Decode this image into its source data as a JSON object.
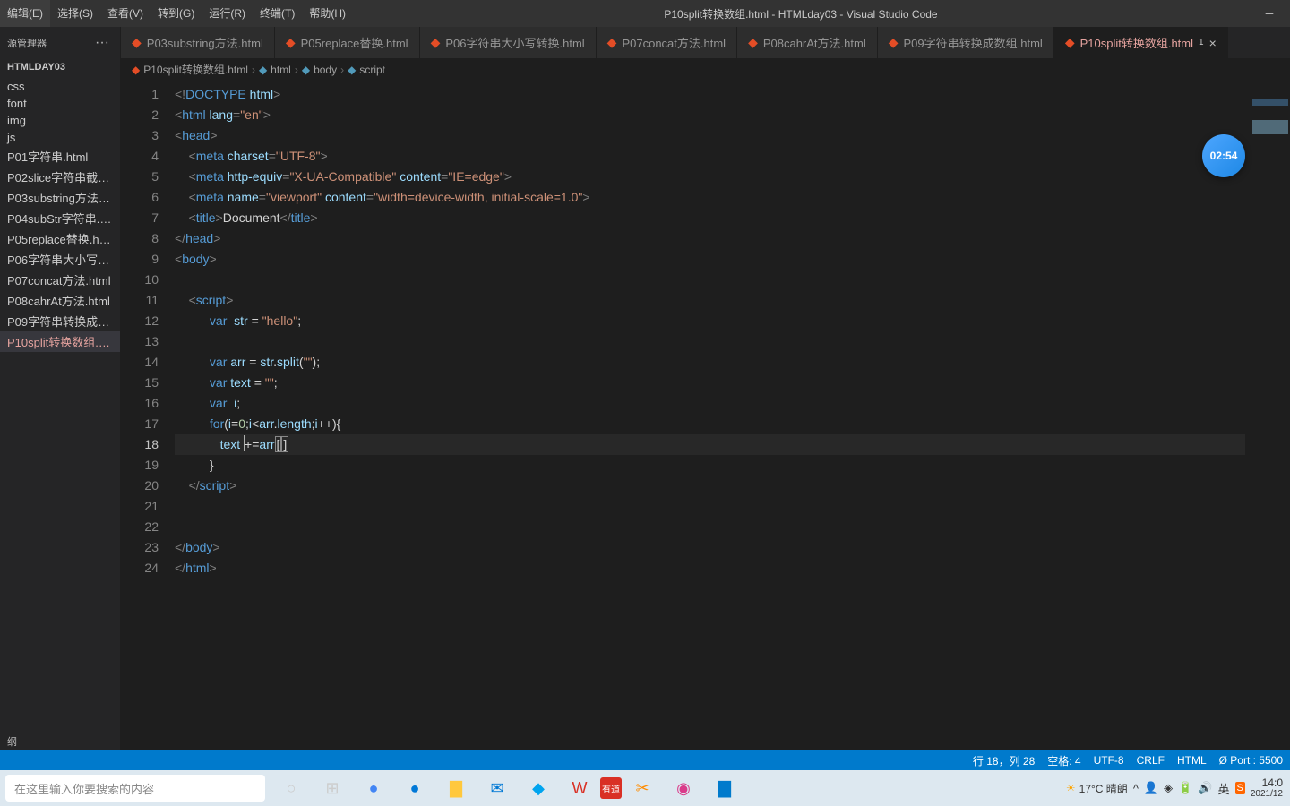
{
  "title": "P10split转换数组.html - HTMLday03 - Visual Studio Code",
  "menu": [
    "编辑(E)",
    "选择(S)",
    "查看(V)",
    "转到(G)",
    "运行(R)",
    "终端(T)",
    "帮助(H)"
  ],
  "sidebar": {
    "title": "源管理器",
    "more": "···",
    "project": "HTMLDAY03",
    "files": [
      {
        "name": "css"
      },
      {
        "name": "font"
      },
      {
        "name": "img"
      },
      {
        "name": "js"
      },
      {
        "name": "P01字符串.html"
      },
      {
        "name": "P02slice字符串截取.ht..."
      },
      {
        "name": "P03substring方法.html"
      },
      {
        "name": "P04subStr字符串.html"
      },
      {
        "name": "P05replace替换.html"
      },
      {
        "name": "P06字符串大小写转换..."
      },
      {
        "name": "P07concat方法.html"
      },
      {
        "name": "P08cahrAt方法.html"
      },
      {
        "name": "P09字符串转换成数组..."
      },
      {
        "name": "P10split转换数组....",
        "active": true,
        "dirty": "1"
      }
    ],
    "outline": "纲"
  },
  "tabs": [
    {
      "label": "P03substring方法.html",
      "active": false,
      "modified": false
    },
    {
      "label": "P05replace替换.html",
      "active": false,
      "modified": false
    },
    {
      "label": "P06字符串大小写转换.html",
      "active": false,
      "modified": false
    },
    {
      "label": "P07concat方法.html",
      "active": false,
      "modified": false
    },
    {
      "label": "P08cahrAt方法.html",
      "active": false,
      "modified": false
    },
    {
      "label": "P09字符串转换成数组.html",
      "active": false,
      "modified": false
    },
    {
      "label": "P10split转换数组.html",
      "active": true,
      "modified": true,
      "dirty": "1"
    }
  ],
  "breadcrumbs": [
    {
      "label": "P10split转换数组.html",
      "icon": "html"
    },
    {
      "label": "html",
      "icon": "tag"
    },
    {
      "label": "body",
      "icon": "tag"
    },
    {
      "label": "script",
      "icon": "tag"
    }
  ],
  "timer_badge": "02:54",
  "lines_count": 24,
  "current_line_idx": 18,
  "statusbar": {
    "line_col": "行 18，列 28",
    "spaces": "空格: 4",
    "encoding": "UTF-8",
    "eol": "CRLF",
    "lang": "HTML",
    "port": "Ø Port : 5500"
  },
  "taskbar": {
    "search_placeholder": "在这里输入你要搜索的内容",
    "weather": "17°C 晴朗",
    "time": "14:0",
    "date": "2021/12"
  }
}
